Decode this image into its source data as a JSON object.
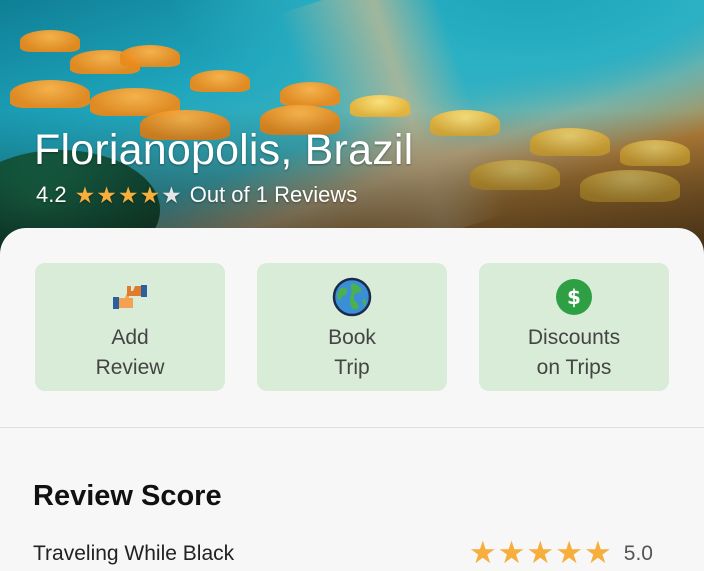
{
  "hero": {
    "title": "Florianopolis, Brazil",
    "rating": "4.2",
    "stars_filled": 4,
    "stars_total": 5,
    "reviews_text": "Out of 1 Reviews"
  },
  "actions": [
    {
      "label_line1": "Add",
      "label_line2": "Review",
      "icon": "thumbs-review-icon"
    },
    {
      "label_line1": "Book",
      "label_line2": "Trip",
      "icon": "globe-icon"
    },
    {
      "label_line1": "Discounts",
      "label_line2": "on Trips",
      "icon": "dollar-coin-icon"
    }
  ],
  "review_score": {
    "title": "Review Score",
    "items": [
      {
        "name": "Traveling While Black",
        "value": "5.0",
        "stars_filled": 5
      }
    ]
  },
  "colors": {
    "action_bg": "#d9ecd8",
    "star": "#f6ae3c",
    "coin": "#2ea043"
  }
}
